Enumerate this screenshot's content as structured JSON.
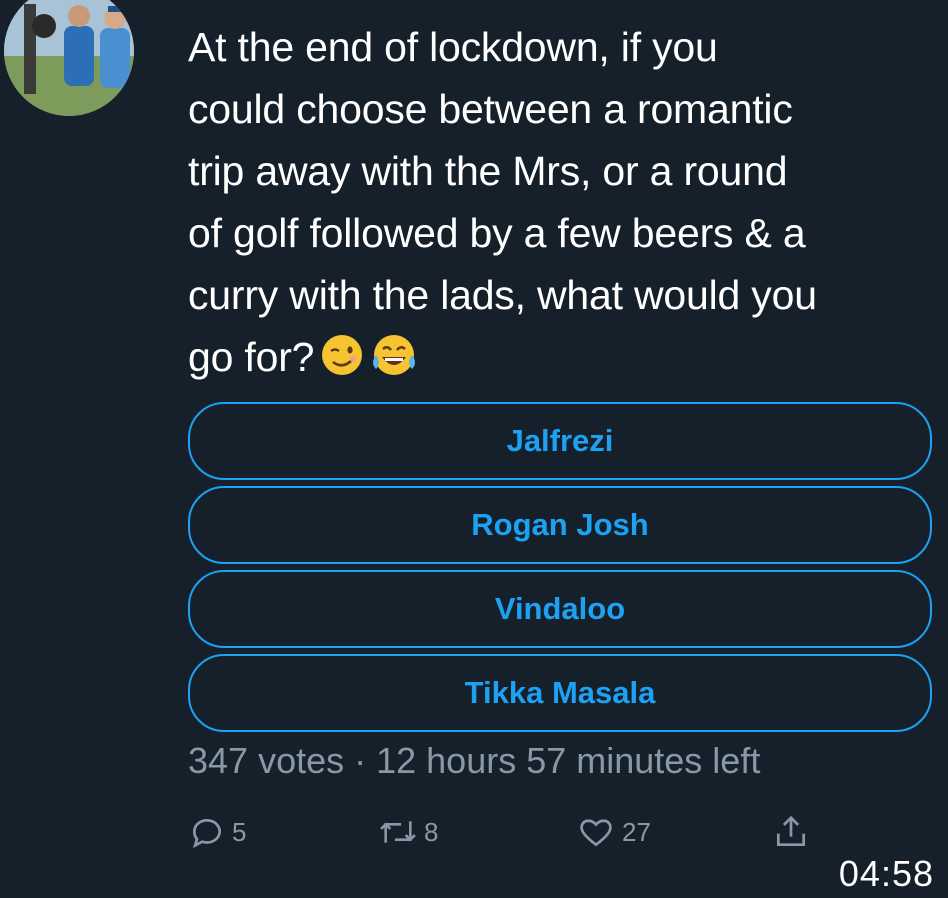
{
  "tweet": {
    "text": "At the end of lockdown, if you\ncould choose between a romantic\ntrip away with the Mrs, or a round\nof golf followed by a few beers & a\ncurry with the lads, what would you\ngo for?",
    "emojis": [
      "winking-face-emoji",
      "tears-of-joy-emoji"
    ]
  },
  "poll": {
    "options": [
      {
        "label": "Jalfrezi"
      },
      {
        "label": "Rogan Josh"
      },
      {
        "label": "Vindaloo"
      },
      {
        "label": "Tikka Masala"
      }
    ],
    "meta": "347 votes · 12 hours 57 minutes left"
  },
  "actions": {
    "reply": {
      "icon": "reply-icon",
      "count": "5"
    },
    "retweet": {
      "icon": "retweet-icon",
      "count": "8"
    },
    "like": {
      "icon": "heart-icon",
      "count": "27"
    },
    "share": {
      "icon": "share-icon"
    }
  },
  "status": {
    "time": "04:58"
  },
  "colors": {
    "background": "#15202b",
    "accent": "#1da1f2",
    "secondary_text": "#8899a6"
  }
}
